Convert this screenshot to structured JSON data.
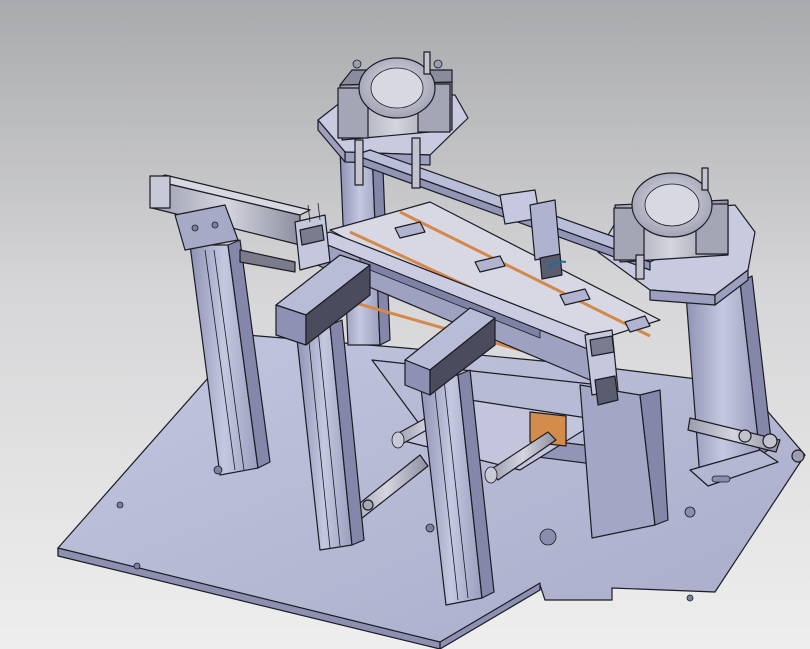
{
  "viewport": {
    "background_top": "#a9aaad",
    "background_bottom": "#eeeeee"
  },
  "colors": {
    "part_light": "#c9cbe0",
    "part_mid": "#a7aac7",
    "part_dark": "#7c7fa3",
    "edge": "#1c1c24",
    "belt_accent": "#d4894a",
    "cylinder_cap": "#b8bac8"
  }
}
